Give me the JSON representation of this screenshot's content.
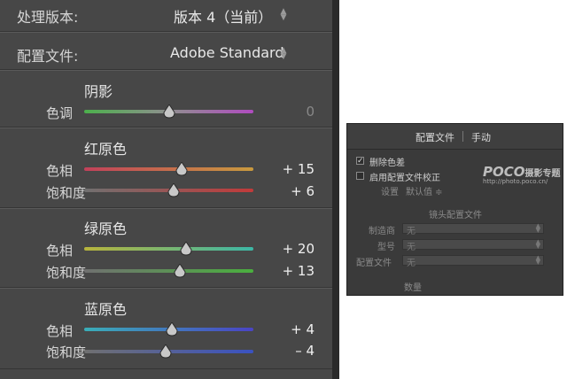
{
  "left_panel": {
    "process": {
      "label": "处理版本:",
      "value": "版本 4（当前）"
    },
    "profile": {
      "label": "配置文件:",
      "value": "Adobe Standard"
    },
    "groups": [
      {
        "title": "阴影",
        "sliders": [
          {
            "label": "色调",
            "value": "0",
            "position": 0.5
          }
        ]
      },
      {
        "title": "红原色",
        "sliders": [
          {
            "label": "色相",
            "value": "+ 15",
            "position": 0.575
          },
          {
            "label": "饱和度",
            "value": "+ 6",
            "position": 0.53
          }
        ]
      },
      {
        "title": "绿原色",
        "sliders": [
          {
            "label": "色相",
            "value": "+ 20",
            "position": 0.6
          },
          {
            "label": "饱和度",
            "value": "+ 13",
            "position": 0.565
          }
        ]
      },
      {
        "title": "蓝原色",
        "sliders": [
          {
            "label": "色相",
            "value": "+ 4",
            "position": 0.52
          },
          {
            "label": "饱和度",
            "value": "– 4",
            "position": 0.48
          }
        ]
      }
    ],
    "colors": {
      "shadow_track": [
        "#4cb04c",
        "#8f8f8f",
        "#b04cc0"
      ],
      "red_hue_track": [
        "#c2415a",
        "#c99a3e"
      ],
      "red_sat_track": [
        "#707070",
        "#c23a3a"
      ],
      "green_hue_track": [
        "#b7b43c",
        "#3cb7a6"
      ],
      "green_sat_track": [
        "#707070",
        "#4ab03e"
      ],
      "blue_hue_track": [
        "#3aaeb8",
        "#4a44c4"
      ],
      "blue_sat_track": [
        "#707070",
        "#3a52c2"
      ]
    }
  },
  "right_panel": {
    "tabs": [
      "配置文件",
      "手动"
    ],
    "checkboxes": [
      {
        "label": "删除色差",
        "checked": true
      },
      {
        "label": "启用配置文件校正",
        "checked": false
      }
    ],
    "setup": {
      "label": "设置",
      "value": "默认值 ≑"
    },
    "lens_profile_header": "镜头配置文件",
    "fields": [
      {
        "label": "制造商",
        "value": "无"
      },
      {
        "label": "型号",
        "value": "无"
      },
      {
        "label": "配置文件",
        "value": "无"
      }
    ],
    "amount_header": "数量",
    "watermark": {
      "brand": "POCO",
      "sub": "摄影专题",
      "url": "http://photo.poco.cn/"
    }
  }
}
